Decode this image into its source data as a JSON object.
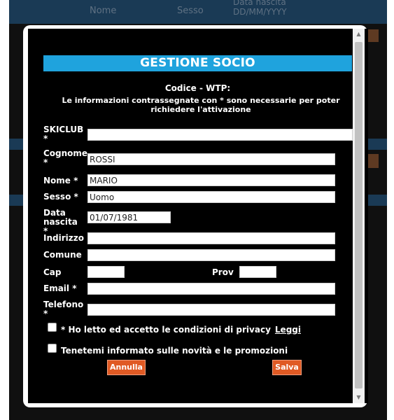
{
  "background": {
    "header_cols": [
      "Nome",
      "Sesso",
      "Data nascita DD/MM/YYYY"
    ]
  },
  "modal": {
    "title": "GESTIONE SOCIO",
    "codice": "Codice - WTP:",
    "info": "Le informazioni contrassegnate con * sono necessarie per poter richiedere l'attivazione",
    "fields": {
      "skiclub": {
        "label": "SKICLUB *",
        "value": ""
      },
      "cognome": {
        "label": "Cognome *",
        "value": "ROSSI"
      },
      "nome": {
        "label": "Nome *",
        "value": "MARIO"
      },
      "sesso": {
        "label": "Sesso *",
        "value": "Uomo"
      },
      "data_nascita": {
        "label": "Data nascita *",
        "value": "01/07/1981"
      },
      "indirizzo": {
        "label": "Indirizzo",
        "value": ""
      },
      "comune": {
        "label": "Comune",
        "value": ""
      },
      "cap": {
        "label": "Cap",
        "value": ""
      },
      "prov": {
        "label": "Prov",
        "value": ""
      },
      "email": {
        "label": "Email *",
        "value": ""
      },
      "telefono": {
        "label": "Telefono *",
        "value": ""
      }
    },
    "privacy_text": "* Ho letto ed accetto le condizioni di privacy",
    "privacy_link": "Leggi",
    "newsletter_text": "Tenetemi informato sulle novità e le promozioni",
    "cancel_label": "Annulla",
    "save_label": "Salva"
  }
}
